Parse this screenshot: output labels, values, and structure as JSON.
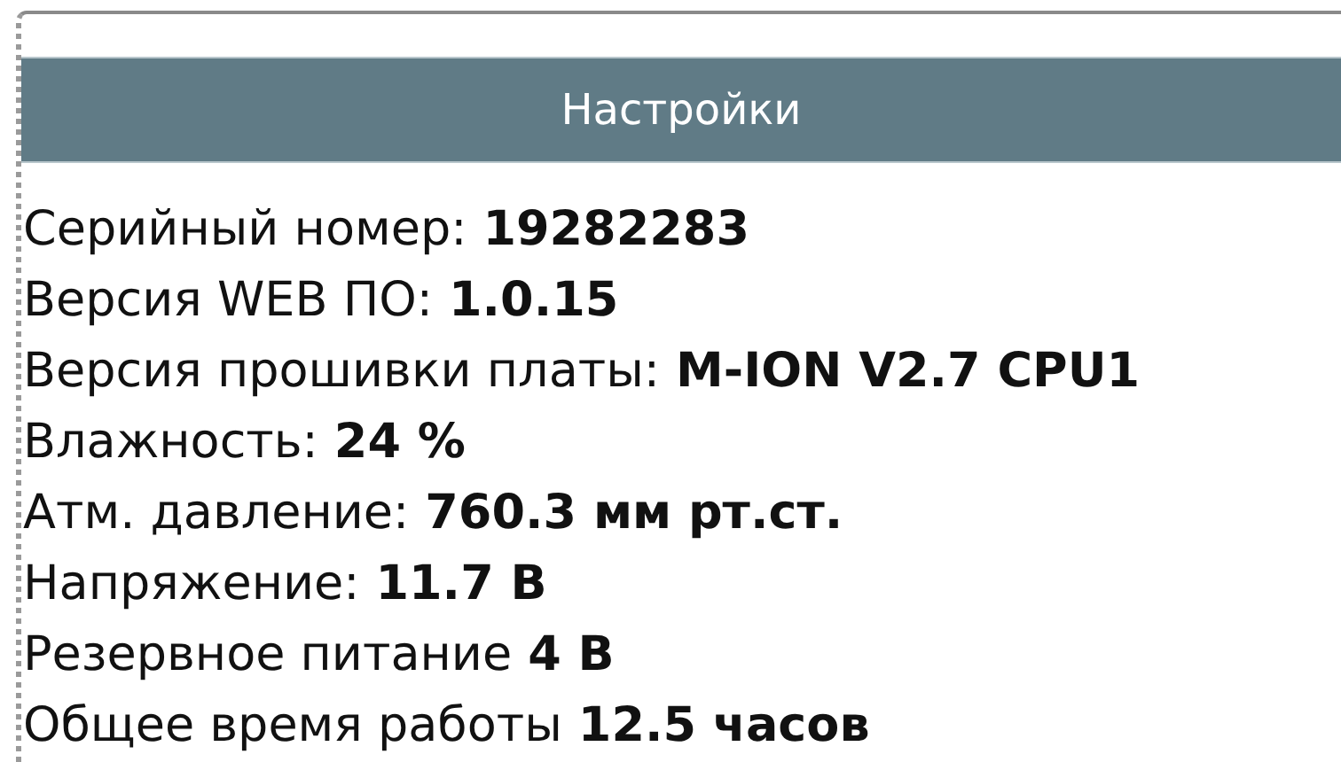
{
  "header": {
    "title": "Настройки"
  },
  "rows": [
    {
      "label": "Серийный номер:",
      "value": "19282283"
    },
    {
      "label": "Версия WEB ПО:",
      "value": "1.0.15"
    },
    {
      "label": "Версия прошивки платы:",
      "value": "M-ION V2.7 CPU1"
    },
    {
      "label": "Влажность:",
      "value": "24 %"
    },
    {
      "label": "Атм. давление:",
      "value": "760.3 мм рт.ст."
    },
    {
      "label": "Напряжение:",
      "value": "11.7 В"
    },
    {
      "label": "Резервное питание",
      "value": "4 В"
    },
    {
      "label": "Общее время работы",
      "value": "12.5 часов"
    }
  ]
}
